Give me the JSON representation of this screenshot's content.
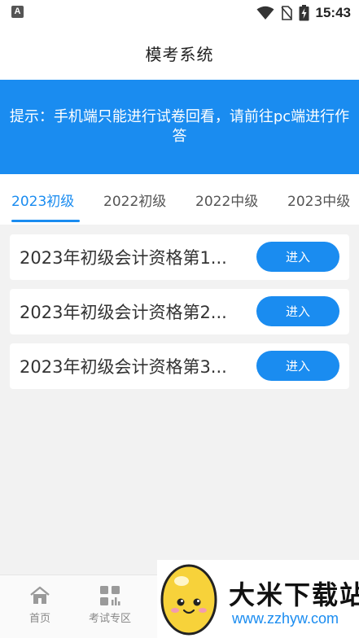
{
  "status_bar": {
    "left_badge": "A",
    "time": "15:43"
  },
  "header": {
    "title": "模考系统"
  },
  "notice": {
    "text": "提示：手机端只能进行试卷回看，请前往pc端进行作答"
  },
  "tabs": [
    {
      "label": "2023初级",
      "active": true
    },
    {
      "label": "2022初级",
      "active": false
    },
    {
      "label": "2022中级",
      "active": false
    },
    {
      "label": "2023中级",
      "active": false
    }
  ],
  "exams": [
    {
      "title": "2023年初级会计资格第1...",
      "button": "进入"
    },
    {
      "title": "2023年初级会计资格第2...",
      "button": "进入"
    },
    {
      "title": "2023年初级会计资格第3...",
      "button": "进入"
    }
  ],
  "bottom_nav": [
    {
      "label": "首页",
      "icon": "home-icon"
    },
    {
      "label": "考试专区",
      "icon": "grid-icon"
    }
  ],
  "watermark": {
    "name": "大米下载站",
    "url": "www.zzhyw.com"
  },
  "colors": {
    "accent": "#1a8cf0",
    "background": "#f2f2f2",
    "card": "#ffffff"
  }
}
